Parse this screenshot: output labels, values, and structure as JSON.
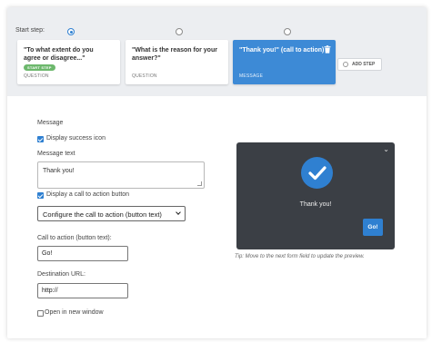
{
  "steps_bar": {
    "start_label": "Start step:",
    "add_step_label": "ADD STEP",
    "cards": [
      {
        "title": "\"To what extent do you agree or disagree...\"",
        "badge": "START STEP",
        "type": "QUESTION"
      },
      {
        "title": "\"What is the reason for your answer?\"",
        "type": "QUESTION"
      },
      {
        "title": "\"Thank you!\" (call to action)",
        "type": "MESSAGE"
      }
    ]
  },
  "form": {
    "section_label": "Message",
    "display_success_icon_label": "Display success icon",
    "message_text_label": "Message text",
    "message_text_value": "Thank you!",
    "display_cta_label": "Display a call to action button",
    "cta_select_value": "Configure the call to action (button text)",
    "cta_text_label": "Call to action (button text):",
    "cta_text_value": "Go!",
    "destination_url_label": "Destination URL:",
    "destination_url_value": "http://",
    "open_new_window_label": "Open in new window"
  },
  "preview": {
    "message": "Thank you!",
    "button_label": "Go!",
    "tip": "Tip: Move to the next form field to update the preview."
  },
  "colors": {
    "accent": "#2f80d1",
    "preview_bg": "#3b3f45",
    "badge": "#6db86d"
  }
}
